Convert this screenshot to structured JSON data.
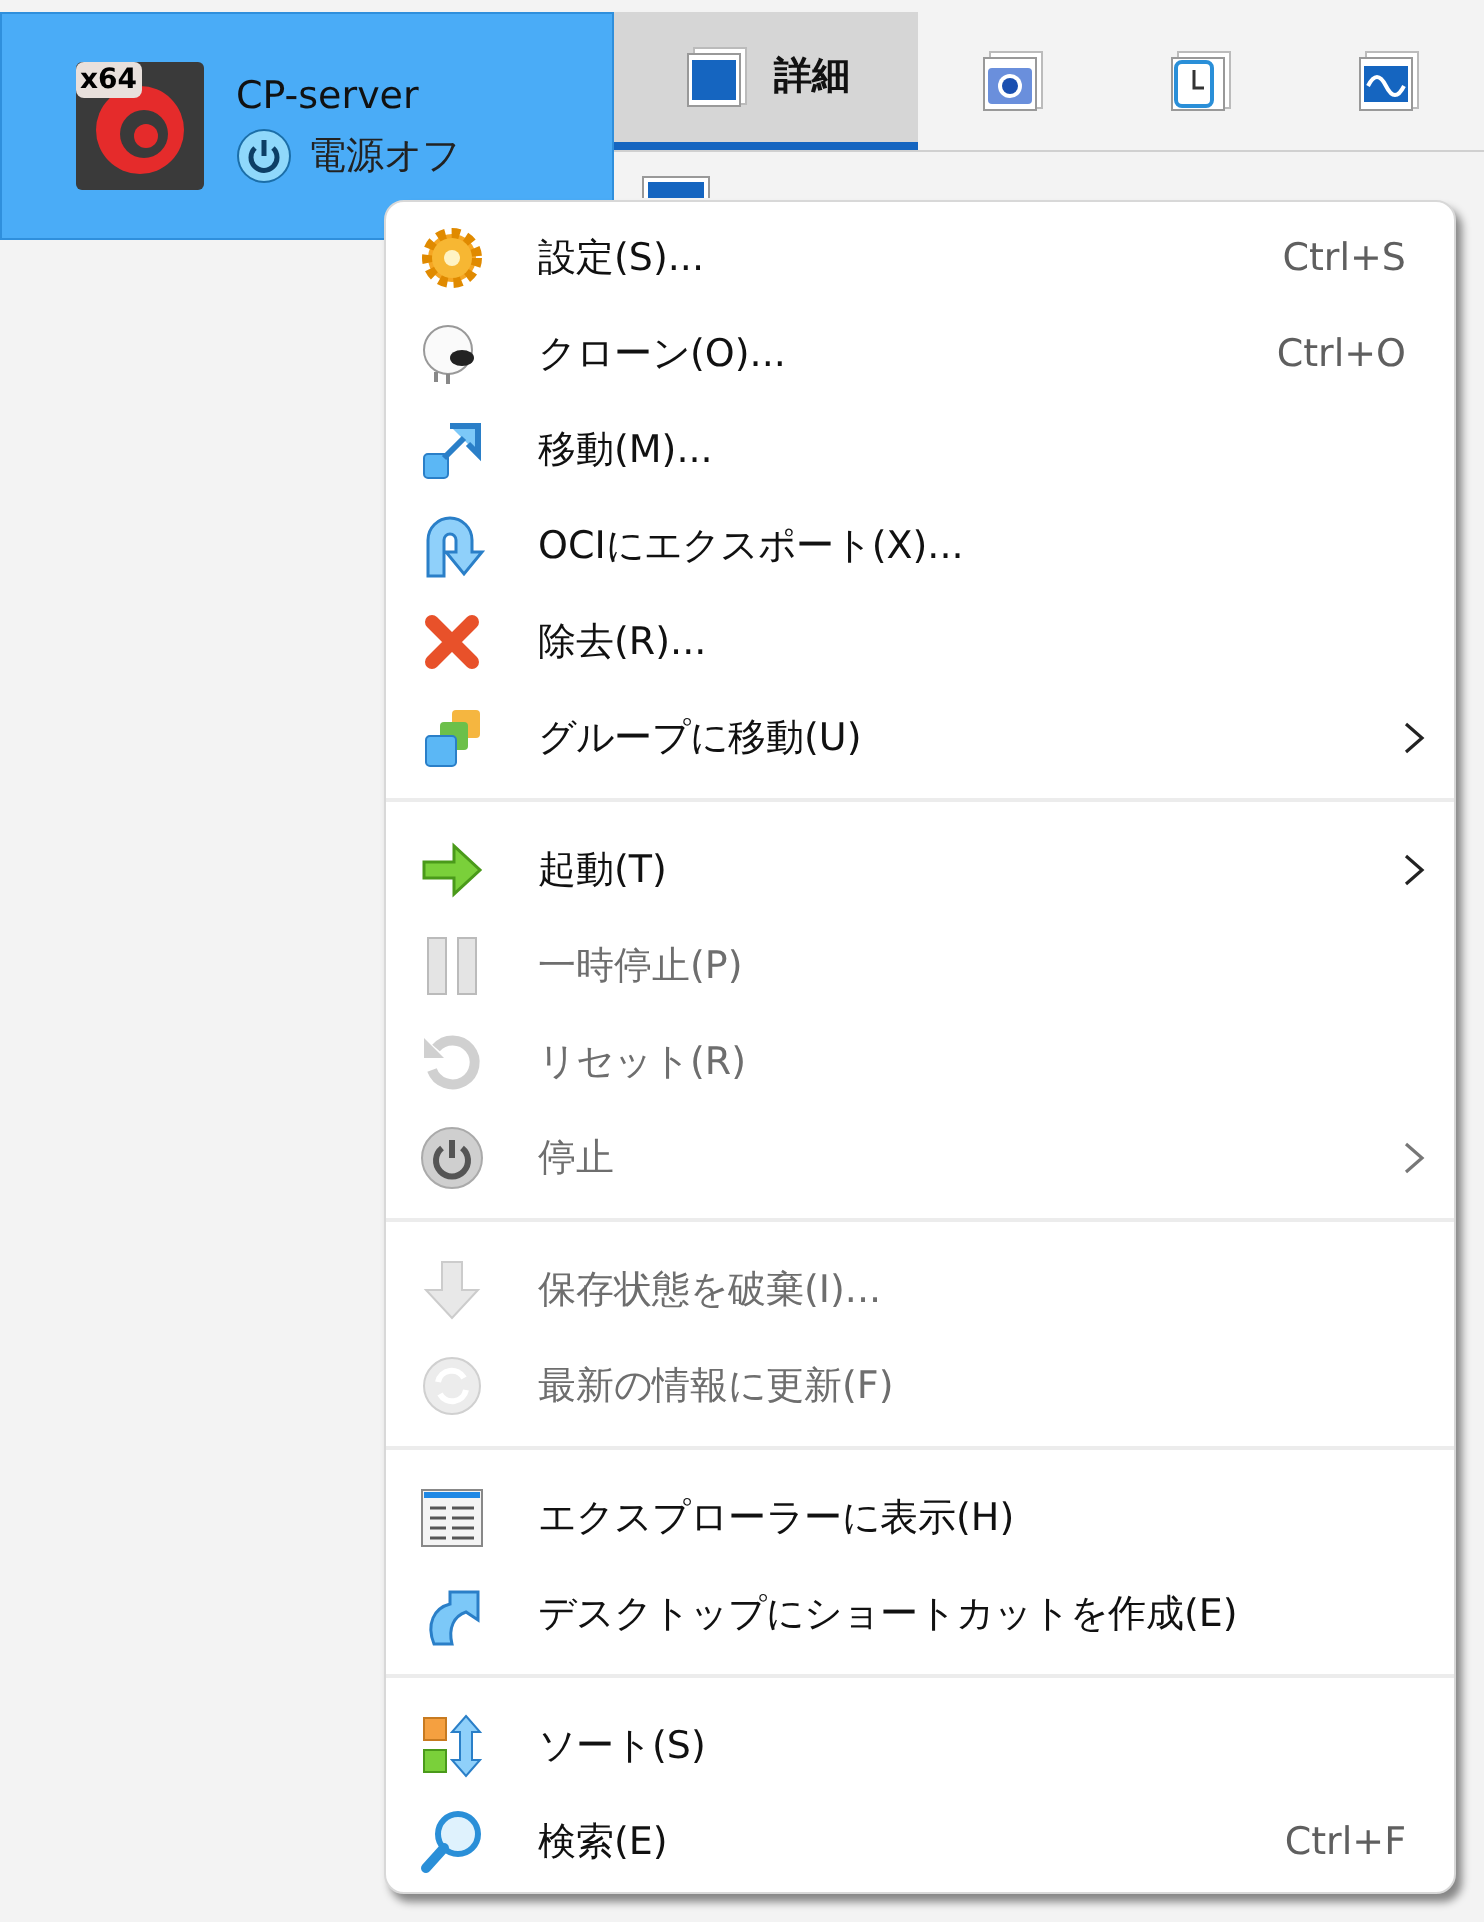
{
  "vm": {
    "name": "CP-server",
    "arch": "x64",
    "state": "電源オフ",
    "selected": true
  },
  "tabs": [
    {
      "kind": "details",
      "label": "詳細",
      "selected": true
    },
    {
      "kind": "snapshots",
      "selected": false
    },
    {
      "kind": "logs",
      "selected": false
    },
    {
      "kind": "activity",
      "selected": false
    }
  ],
  "menu": {
    "sections": [
      [
        {
          "kind": "settings",
          "label": "設定(S)...",
          "shortcut": "Ctrl+S",
          "submenu": false,
          "disabled": false
        },
        {
          "kind": "clone",
          "label": "クローン(O)...",
          "shortcut": "Ctrl+O",
          "submenu": false,
          "disabled": false
        },
        {
          "kind": "move",
          "label": "移動(M)...",
          "submenu": false,
          "disabled": false
        },
        {
          "kind": "export",
          "label": "OCIにエクスポート(X)...",
          "submenu": false,
          "disabled": false
        },
        {
          "kind": "remove",
          "label": "除去(R)...",
          "submenu": false,
          "disabled": false
        },
        {
          "kind": "group",
          "label": "グループに移動(U)",
          "submenu": true,
          "disabled": false
        }
      ],
      [
        {
          "kind": "start",
          "label": "起動(T)",
          "submenu": true,
          "disabled": false
        },
        {
          "kind": "pause",
          "label": "一時停止(P)",
          "submenu": false,
          "disabled": true
        },
        {
          "kind": "reset",
          "label": "リセット(R)",
          "submenu": false,
          "disabled": true
        },
        {
          "kind": "power",
          "label": "停止",
          "submenu": true,
          "disabled": true
        }
      ],
      [
        {
          "kind": "discard",
          "label": "保存状態を破棄(I)...",
          "submenu": false,
          "disabled": true
        },
        {
          "kind": "refresh",
          "label": "最新の情報に更新(F)",
          "submenu": false,
          "disabled": true
        }
      ],
      [
        {
          "kind": "explorer",
          "label": "エクスプローラーに表示(H)",
          "submenu": false,
          "disabled": false
        },
        {
          "kind": "shortcut",
          "label": "デスクトップにショートカットを作成(E)",
          "submenu": false,
          "disabled": false
        }
      ],
      [
        {
          "kind": "sort",
          "label": "ソート(S)",
          "submenu": false,
          "disabled": false
        },
        {
          "kind": "search",
          "label": "検索(E)",
          "shortcut": "Ctrl+F",
          "submenu": false,
          "disabled": false
        }
      ]
    ]
  }
}
